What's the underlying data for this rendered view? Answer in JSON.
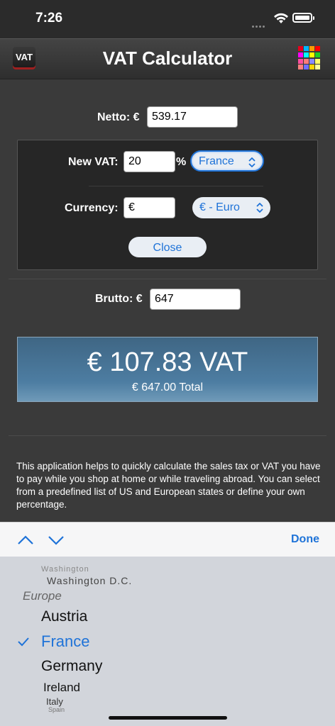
{
  "status_bar": {
    "time": "7:26"
  },
  "nav": {
    "logo_text": "VAT",
    "title": "VAT Calculator"
  },
  "form": {
    "netto_label": "Netto: €",
    "netto_value": "539.17",
    "new_vat_label": "New VAT:",
    "new_vat_value": "20",
    "percent_sign": "%",
    "country_select": "France",
    "currency_label": "Currency:",
    "currency_value": "€",
    "currency_select": "€ - Euro",
    "close_label": "Close",
    "brutto_label": "Brutto: €",
    "brutto_value": "647"
  },
  "result": {
    "vat_amount": "€ 107.83 VAT",
    "total": "€ 647.00 Total"
  },
  "description": "This application helps to quickly calculate the sales tax or VAT you have to pay while you shop at home or while traveling abroad. You can select from a predefined list of US and European states or define your own percentage.",
  "toolbar": {
    "done_label": "Done"
  },
  "picker": {
    "above_item": "Washington",
    "item_prev": "Washington D.C.",
    "group": "Europe",
    "items": [
      "Austria",
      "France",
      "Germany",
      "Ireland",
      "Italy"
    ],
    "below_item": "Spain",
    "selected": "France"
  },
  "colors": {
    "accent": "#1f73d8",
    "background": "#3a3a3a",
    "result_blue": "#4d7da2"
  }
}
